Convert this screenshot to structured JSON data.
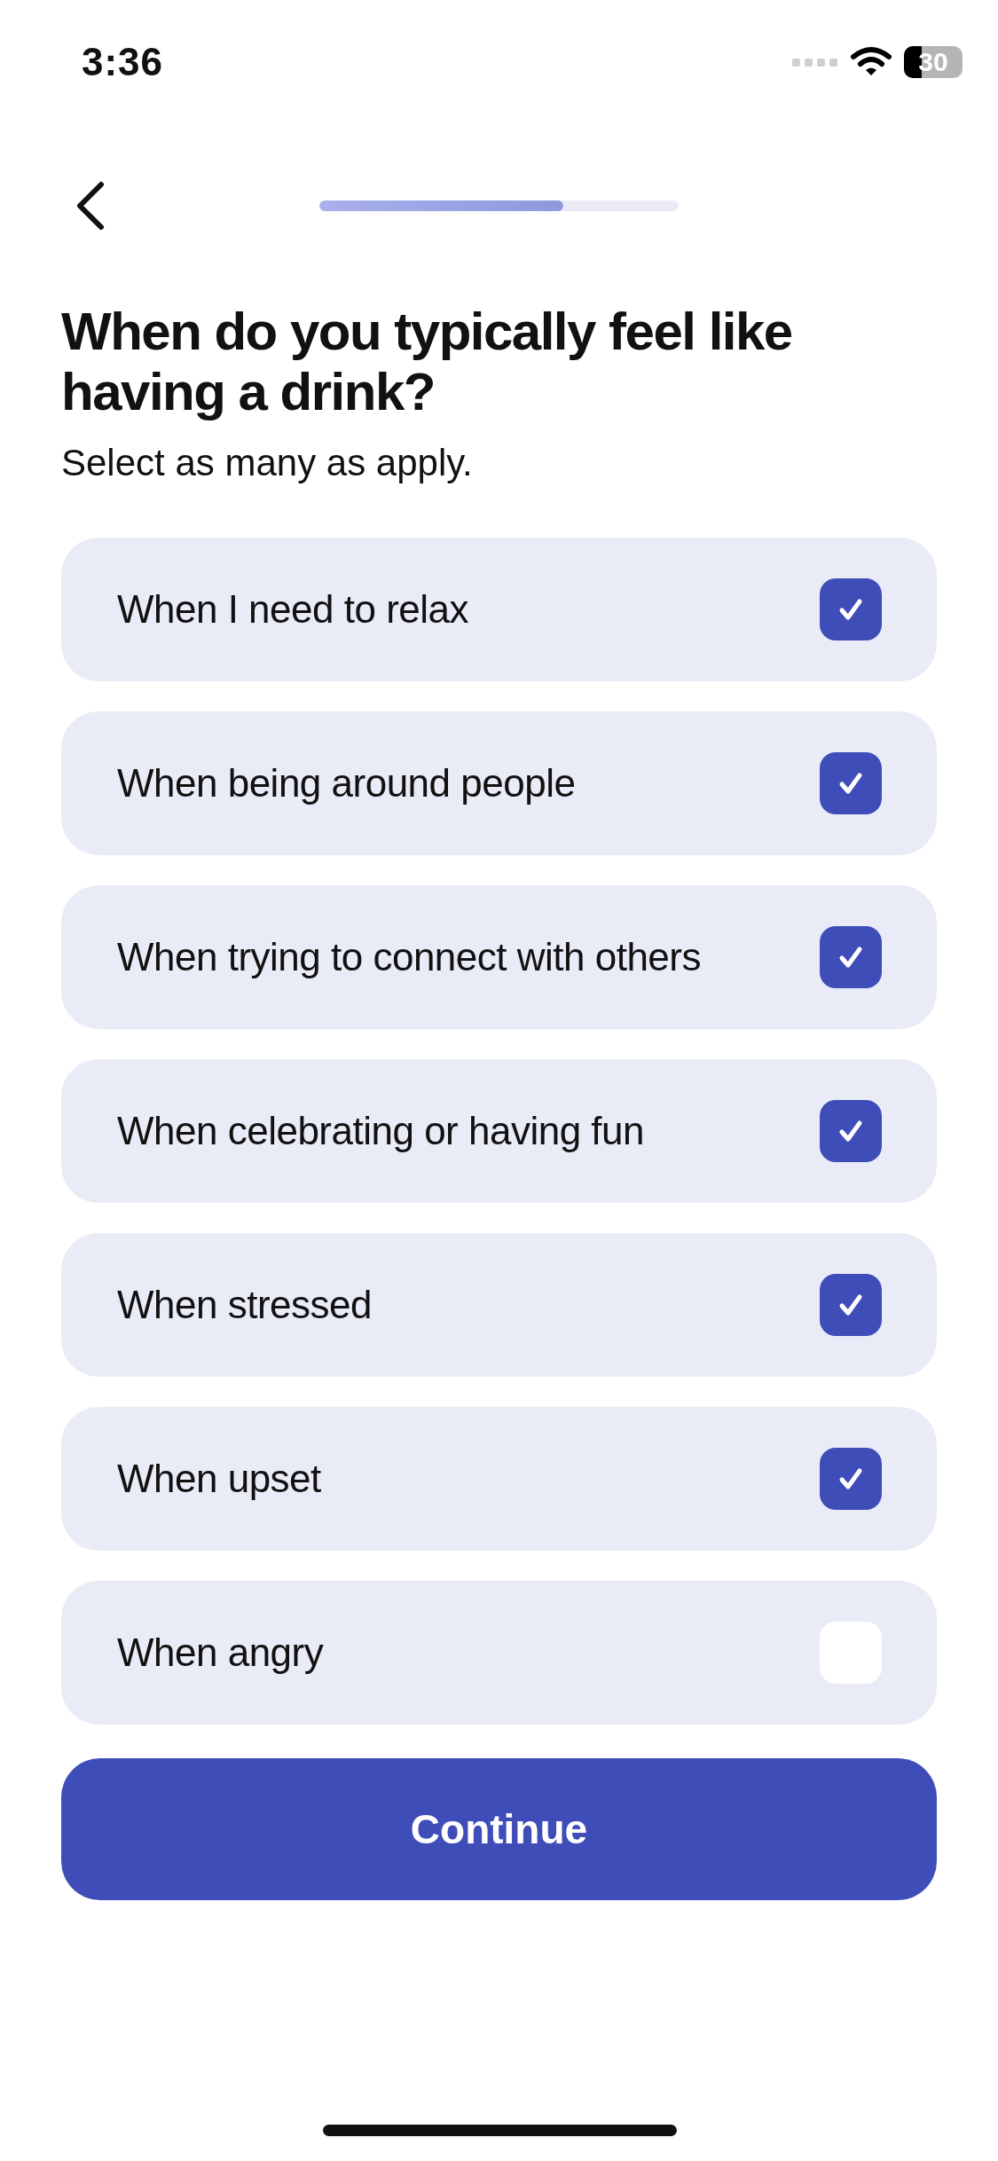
{
  "status_bar": {
    "time": "3:36",
    "battery": "30"
  },
  "progress": {
    "level": 0.68
  },
  "title": "When do you typically feel like having a drink?",
  "subtitle": "Select as many as apply.",
  "options": [
    {
      "label": "When I need to relax",
      "checked": true
    },
    {
      "label": "When being around people",
      "checked": true
    },
    {
      "label": "When trying to connect with others",
      "checked": true
    },
    {
      "label": "When celebrating or having fun",
      "checked": true
    },
    {
      "label": "When stressed",
      "checked": true
    },
    {
      "label": "When upset",
      "checked": true
    },
    {
      "label": "When angry",
      "checked": false
    }
  ],
  "continue_button": "Continue"
}
